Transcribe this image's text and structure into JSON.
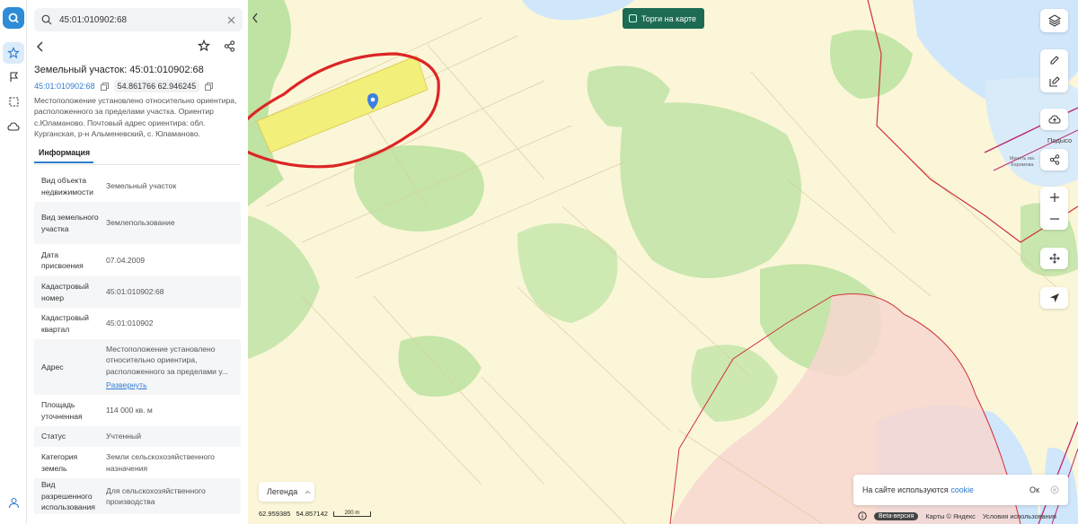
{
  "search": {
    "query": "45:01:010902:68"
  },
  "panel": {
    "title": "Земельный участок: 45:01:010902:68",
    "cadastral_link": "45:01:010902:68",
    "coords": "54.861766 62.946245",
    "description": "Местоположение установлено относительно ориентира, расположенного за пределами участка. Ориентир с.Юламаново. Почтовый адрес ориентира: обл. Курганская, р-н Альменевский, с. Юламаново.",
    "tab": "Информация",
    "rows": [
      {
        "key": "Вид объекта недвижимости",
        "value": "Земельный участок"
      },
      {
        "key": "Вид земельного участка",
        "value": "Землепользование"
      },
      {
        "key": "Дата присвоения",
        "value": "07.04.2009"
      },
      {
        "key": "Кадастровый номер",
        "value": "45:01:010902:68"
      },
      {
        "key": "Кадастровый квартал",
        "value": "45:01:010902"
      },
      {
        "key": "Адрес",
        "value": "Местоположение установлено относительно ориентира, расположенного за пределами у...",
        "link": "Развернуть"
      },
      {
        "key": "Площадь уточненная",
        "value": "114 000 кв. м"
      },
      {
        "key": "Статус",
        "value": "Учтенный"
      },
      {
        "key": "Категория земель",
        "value": "Земли сельскохозяйственного назначения"
      },
      {
        "key": "Вид разрешенного использования",
        "value": "Для сельскохозяйственного производства"
      }
    ]
  },
  "map": {
    "torgi_label": "Торги на карте",
    "legend_label": "Легенда",
    "coords_readout_lon": "62.959385",
    "coords_readout_lat": "54.857142",
    "scale_label": "200 m",
    "poi_mosque": "Мечеть им. Каримова",
    "place_partial": "Подысо",
    "cookie_text": "На сайте используются",
    "cookie_link": "cookie",
    "cookie_ok": "Ок",
    "beta": "Beta-версия",
    "maps_credit": "Карты © Яндекс",
    "terms": "Условия использования"
  },
  "colors": {
    "accent": "#2e7bd1",
    "torgi_bg": "#1d6b53",
    "selected_plot": "#f2ef7a",
    "forest": "#bfe3a3",
    "water": "#cfe6fb",
    "boundary": "#d0323a"
  }
}
